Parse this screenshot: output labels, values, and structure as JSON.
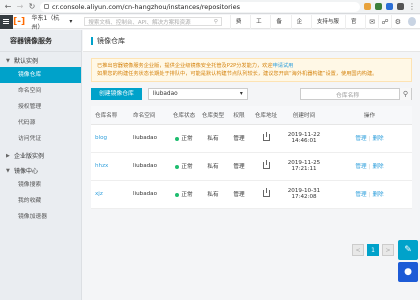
{
  "browser": {
    "url": "cr.console.aliyun.com/cn-hangzhou/instances/repositories"
  },
  "topbar": {
    "logo": "[-]",
    "region": "华东1（杭州）",
    "search_placeholder": "搜索文档、控制台、API、解决方案和资源",
    "nav": [
      "费用",
      "工单",
      "备案",
      "企业",
      "支持与服务",
      "官网"
    ]
  },
  "sidebar": {
    "title": "容器镜像服务",
    "groups": [
      {
        "label": "默认实例",
        "items": [
          "镜像仓库",
          "命名空间",
          "授权管理",
          "代码源",
          "访问凭证"
        ]
      },
      {
        "label": "企业版实例",
        "items": []
      },
      {
        "label": "镜像中心",
        "items": [
          "镜像搜索",
          "我的收藏",
          "镜像加速器"
        ]
      }
    ]
  },
  "main": {
    "title": "镜像仓库",
    "notice_line1": "已推出容器镜像服务企业版，提供企业级镜像安全托管及P2P分发能力，欢迎",
    "notice_link": "申请试用",
    "notice_line2": "如果您的构建任务状态长期处于排队中，可能是默认构建节点队列较长，建议您开启“海外机器构建”设置，使用国内构建。",
    "create_button": "创建镜像仓库",
    "namespace_selected": "liubadao",
    "search_placeholder": "仓库名称"
  },
  "table": {
    "headers": [
      "仓库名称",
      "命名空间",
      "仓库状态",
      "仓库类型",
      "权限",
      "仓库地址",
      "创建时间",
      "操作"
    ],
    "rows": [
      {
        "name": "blog",
        "namespace": "liubadao",
        "status": "正常",
        "type": "私有",
        "permission": "管理",
        "created": "2019-11-22 14:46:01",
        "op_manage": "管理",
        "op_delete": "删除"
      },
      {
        "name": "hhzx",
        "namespace": "liubadao",
        "status": "正常",
        "type": "私有",
        "permission": "管理",
        "created": "2019-11-25 17:21:11",
        "op_manage": "管理",
        "op_delete": "删除"
      },
      {
        "name": "xjz",
        "namespace": "liubadao",
        "status": "正常",
        "type": "私有",
        "permission": "管理",
        "created": "2019-10-31 17:42:08",
        "op_manage": "管理",
        "op_delete": "删除"
      }
    ]
  },
  "pager": {
    "prev": "<",
    "current": "1",
    "next": ">"
  },
  "colors": {
    "accent": "#00a2ca",
    "brand": "#ff6a00",
    "status_ok": "#1ebd6f",
    "link": "#2e9fdc"
  }
}
